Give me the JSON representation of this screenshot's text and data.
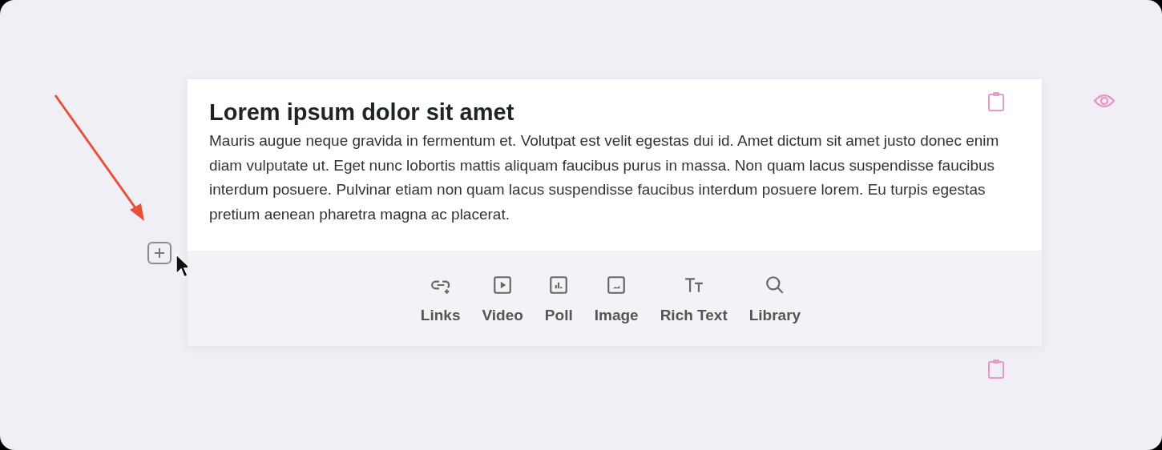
{
  "card": {
    "title": "Lorem ipsum dolor sit amet",
    "body": "Mauris augue neque gravida in fermentum et. Volutpat est velit egestas dui id. Amet dictum sit amet justo donec enim diam vulputate ut. Eget nunc lobortis mattis aliquam faucibus purus in massa. Non quam lacus suspendisse faucibus interdum posuere. Pulvinar etiam non quam lacus suspendisse faucibus interdum posuere lorem. Eu turpis egestas pretium aenean pharetra magna ac placerat."
  },
  "tools": [
    {
      "label": "Links",
      "kind": "link"
    },
    {
      "label": "Video",
      "kind": "video"
    },
    {
      "label": "Poll",
      "kind": "poll"
    },
    {
      "label": "Image",
      "kind": "image"
    },
    {
      "label": "Rich Text",
      "kind": "text"
    },
    {
      "label": "Library",
      "kind": "search"
    }
  ]
}
